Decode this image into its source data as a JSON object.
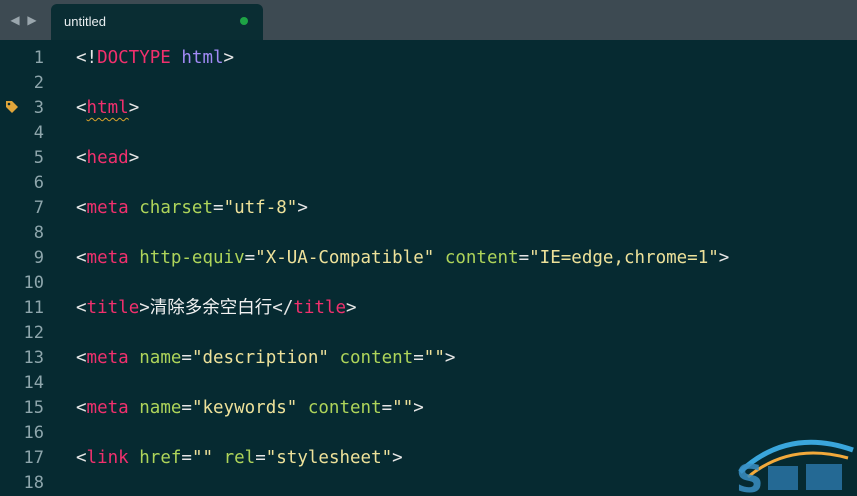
{
  "tab": {
    "title": "untitled"
  },
  "lines": [
    {
      "n": "1",
      "parts": [
        [
          "p",
          "<!"
        ],
        [
          "t",
          "DOCTYPE"
        ],
        [
          "p",
          " "
        ],
        [
          "k",
          "html"
        ],
        [
          "p",
          ">"
        ]
      ]
    },
    {
      "n": "2",
      "parts": []
    },
    {
      "n": "3",
      "parts": [
        [
          "p",
          "<"
        ],
        [
          "tw",
          "html"
        ],
        [
          "p",
          ">"
        ]
      ]
    },
    {
      "n": "4",
      "parts": []
    },
    {
      "n": "5",
      "parts": [
        [
          "p",
          "<"
        ],
        [
          "t",
          "head"
        ],
        [
          "p",
          ">"
        ]
      ]
    },
    {
      "n": "6",
      "parts": []
    },
    {
      "n": "7",
      "parts": [
        [
          "p",
          "<"
        ],
        [
          "t",
          "meta"
        ],
        [
          "p",
          " "
        ],
        [
          "a",
          "charset"
        ],
        [
          "p",
          "="
        ],
        [
          "s",
          "\"utf-8\""
        ],
        [
          "p",
          ">"
        ]
      ]
    },
    {
      "n": "8",
      "parts": []
    },
    {
      "n": "9",
      "parts": [
        [
          "p",
          "<"
        ],
        [
          "t",
          "meta"
        ],
        [
          "p",
          " "
        ],
        [
          "a",
          "http-equiv"
        ],
        [
          "p",
          "="
        ],
        [
          "s",
          "\"X-UA-Compatible\""
        ],
        [
          "p",
          " "
        ],
        [
          "a",
          "content"
        ],
        [
          "p",
          "="
        ],
        [
          "s",
          "\"IE=edge,chrome=1\""
        ],
        [
          "p",
          ">"
        ]
      ]
    },
    {
      "n": "10",
      "parts": []
    },
    {
      "n": "11",
      "parts": [
        [
          "p",
          "<"
        ],
        [
          "t",
          "title"
        ],
        [
          "p",
          ">"
        ],
        [
          "x",
          "清除多余空白行"
        ],
        [
          "p",
          "</"
        ],
        [
          "t",
          "title"
        ],
        [
          "p",
          ">"
        ]
      ]
    },
    {
      "n": "12",
      "parts": []
    },
    {
      "n": "13",
      "parts": [
        [
          "p",
          "<"
        ],
        [
          "t",
          "meta"
        ],
        [
          "p",
          " "
        ],
        [
          "a",
          "name"
        ],
        [
          "p",
          "="
        ],
        [
          "s",
          "\"description\""
        ],
        [
          "p",
          " "
        ],
        [
          "a",
          "content"
        ],
        [
          "p",
          "="
        ],
        [
          "s",
          "\"\""
        ],
        [
          "p",
          ">"
        ]
      ]
    },
    {
      "n": "14",
      "parts": []
    },
    {
      "n": "15",
      "parts": [
        [
          "p",
          "<"
        ],
        [
          "t",
          "meta"
        ],
        [
          "p",
          " "
        ],
        [
          "a",
          "name"
        ],
        [
          "p",
          "="
        ],
        [
          "s",
          "\"keywords\""
        ],
        [
          "p",
          " "
        ],
        [
          "a",
          "content"
        ],
        [
          "p",
          "="
        ],
        [
          "s",
          "\"\""
        ],
        [
          "p",
          ">"
        ]
      ]
    },
    {
      "n": "16",
      "parts": []
    },
    {
      "n": "17",
      "parts": [
        [
          "p",
          "<"
        ],
        [
          "t",
          "link"
        ],
        [
          "p",
          " "
        ],
        [
          "a",
          "href"
        ],
        [
          "p",
          "="
        ],
        [
          "s",
          "\"\""
        ],
        [
          "p",
          " "
        ],
        [
          "a",
          "rel"
        ],
        [
          "p",
          "="
        ],
        [
          "s",
          "\"stylesheet\""
        ],
        [
          "p",
          ">"
        ]
      ]
    },
    {
      "n": "18",
      "parts": []
    }
  ],
  "gutter_marker_line": "3",
  "colors": {
    "background": "#062a31",
    "tag": "#f0306d",
    "attribute": "#aed45a",
    "string": "#ede19a",
    "keyword": "#a18af5",
    "modified_dot": "#1ea345"
  },
  "icons": {
    "nav_back": "caret-left-icon",
    "nav_forward": "caret-right-icon",
    "unsaved": "modified-dot-icon",
    "gutter": "tag-marker-icon",
    "watermark": "watermark-logo"
  }
}
